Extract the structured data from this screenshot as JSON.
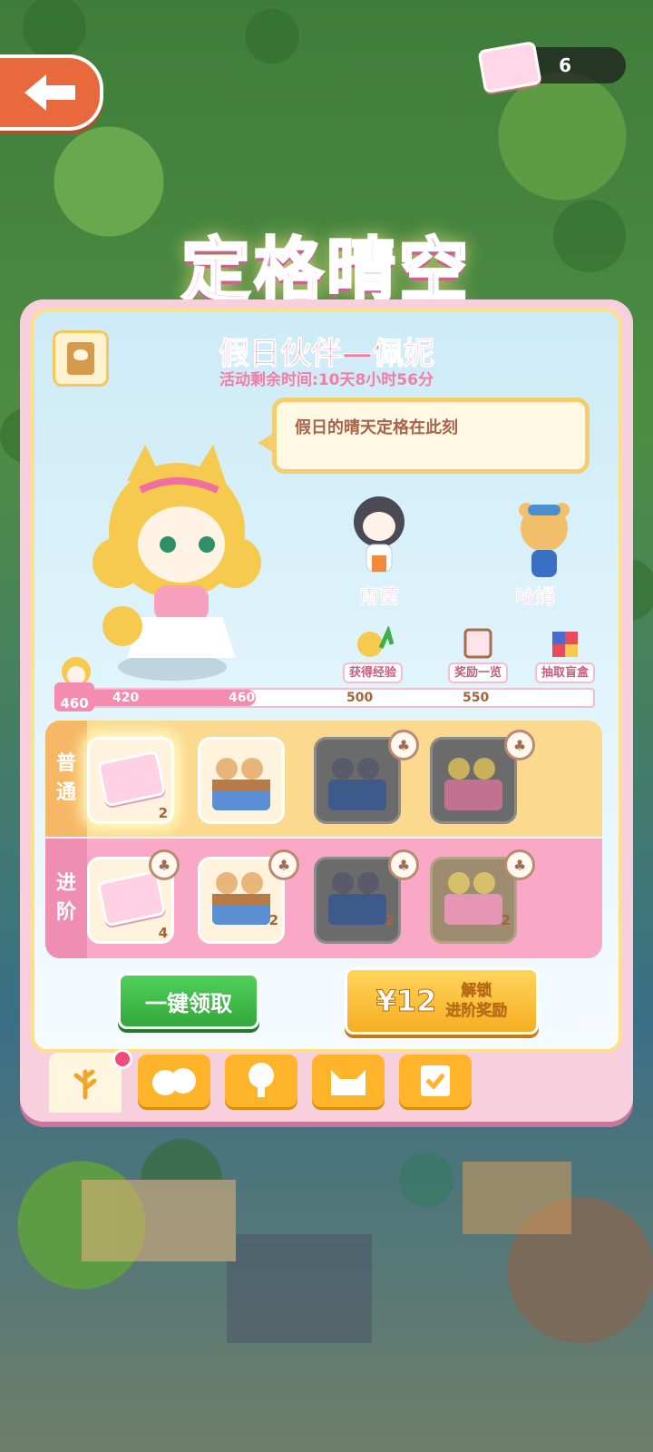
{
  "topbar": {
    "back_icon": "arrow-left-icon",
    "ticket_count": "6"
  },
  "event": {
    "title": "定格晴空",
    "character_title": "假日伙伴—佩妮",
    "timer": "活动剩余时间:10天8小时56分",
    "speech": "假日的晴天定格在此刻"
  },
  "partners": [
    {
      "name": "南茜"
    },
    {
      "name": "哈姆"
    }
  ],
  "milestones": [
    {
      "label": "获得经验"
    },
    {
      "label": "奖励一览"
    },
    {
      "label": "抽取盲盒"
    }
  ],
  "progress": {
    "current_level": "460",
    "ticks": [
      "420",
      "460",
      "500",
      "550"
    ],
    "fill_fraction": 0.37
  },
  "rows": {
    "normal": {
      "tag": [
        "普",
        "通"
      ],
      "items": [
        {
          "count": "2"
        },
        {
          "count": ""
        },
        {
          "count": ""
        },
        {
          "count": ""
        }
      ]
    },
    "advanced": {
      "tag": [
        "进",
        "阶"
      ],
      "items": [
        {
          "count": "4"
        },
        {
          "count": "2"
        },
        {
          "count": "2"
        },
        {
          "count": "2"
        }
      ]
    }
  },
  "buttons": {
    "claim": "一键领取",
    "unlock_price": "¥12",
    "unlock_line1": "解锁",
    "unlock_line2": "进阶奖励"
  },
  "tabs": [
    {
      "icon": "leaf-icon",
      "active": true
    },
    {
      "icon": "chicks-icon",
      "active": false
    },
    {
      "icon": "tree-icon",
      "active": false
    },
    {
      "icon": "cat-face-icon",
      "active": false
    },
    {
      "icon": "heart-check-icon",
      "active": false
    }
  ],
  "colors": {
    "pink": "#f27ea5",
    "yellow": "#fbd98e",
    "green": "#34a83d",
    "orange": "#f7ae23"
  }
}
